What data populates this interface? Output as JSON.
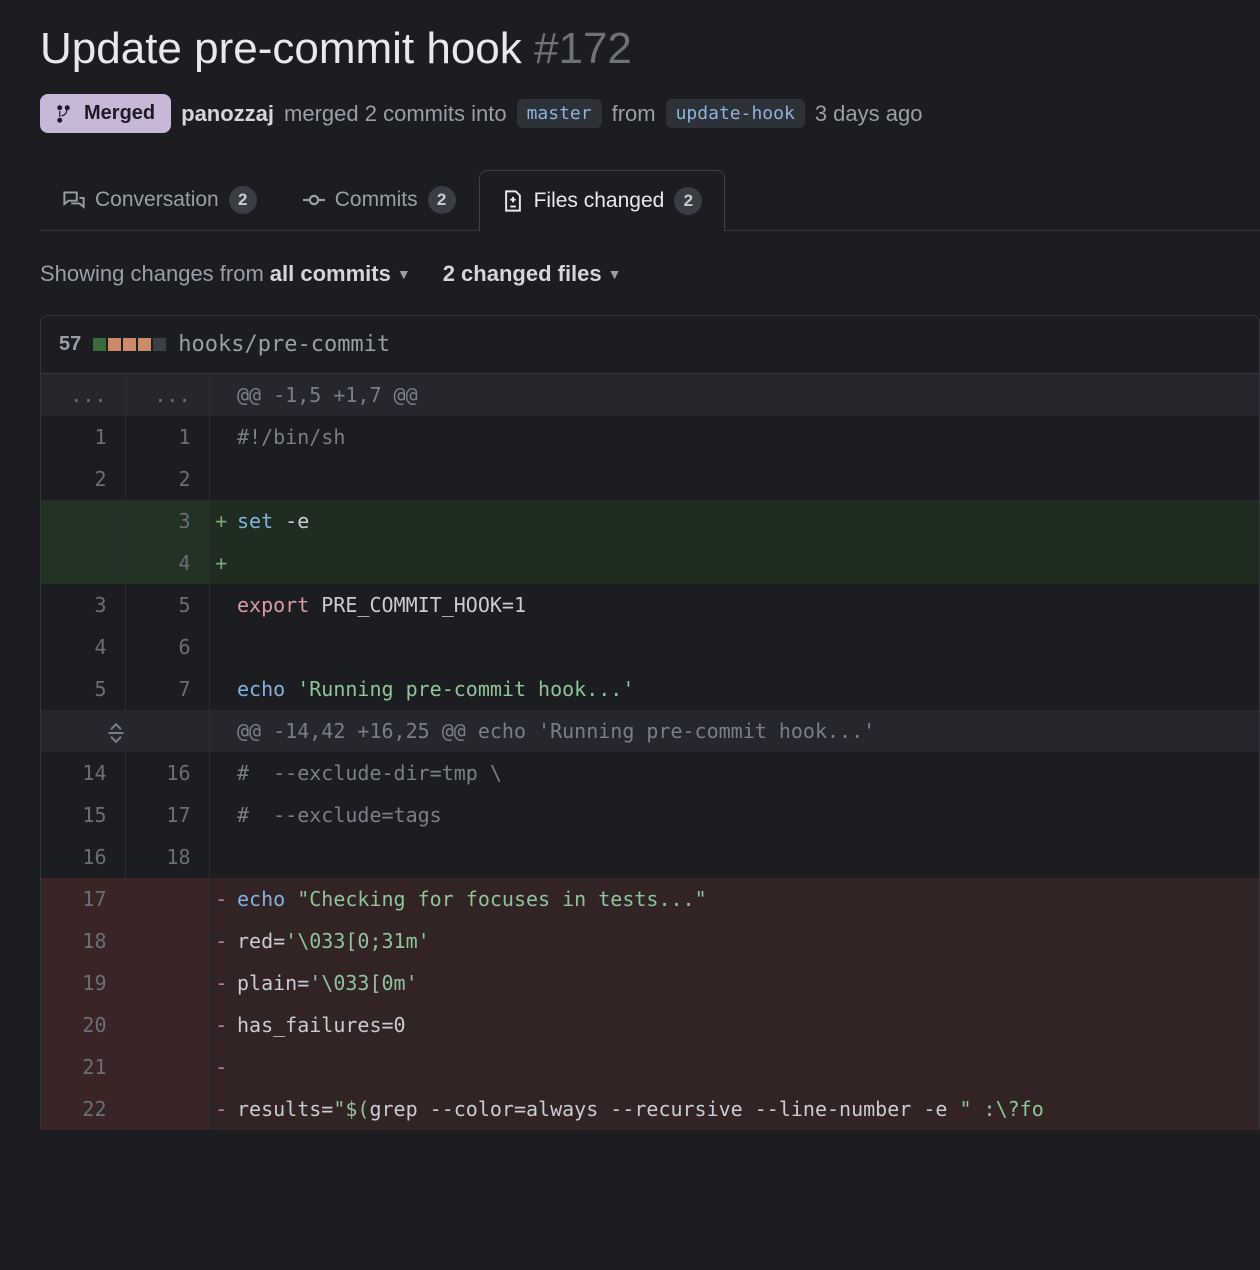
{
  "pr": {
    "title": "Update pre-commit hook",
    "number": "#172",
    "status_label": "Merged",
    "author": "panozzaj",
    "action_text_pre": "merged 2 commits into",
    "base_branch": "master",
    "action_text_mid": "from",
    "head_branch": "update-hook",
    "time_ago": "3 days ago"
  },
  "tabs": {
    "conversation": {
      "label": "Conversation",
      "count": "2"
    },
    "commits": {
      "label": "Commits",
      "count": "2"
    },
    "files": {
      "label": "Files changed",
      "count": "2"
    }
  },
  "toolbar": {
    "showing_prefix": "Showing changes from ",
    "commits_filter": "all commits",
    "files_filter": "2 changed files"
  },
  "file": {
    "stat": "57",
    "path": "hooks/pre-commit"
  },
  "diff": {
    "hunk1": {
      "ln_l": "...",
      "ln_r": "...",
      "text": "@@ -1,5 +1,7 @@"
    },
    "rows1": [
      {
        "type": "context",
        "l": "1",
        "r": "1",
        "html": "<span class='tk-comment'>#!/bin/sh</span>"
      },
      {
        "type": "context",
        "l": "2",
        "r": "2",
        "html": ""
      },
      {
        "type": "addition",
        "l": "",
        "r": "3",
        "html": "<span class='tk-cmd'>set</span> -e"
      },
      {
        "type": "addition",
        "l": "",
        "r": "4",
        "html": ""
      },
      {
        "type": "context",
        "l": "3",
        "r": "5",
        "html": "<span class='tk-kw'>export</span> PRE_COMMIT_HOOK=1"
      },
      {
        "type": "context",
        "l": "4",
        "r": "6",
        "html": ""
      },
      {
        "type": "context",
        "l": "5",
        "r": "7",
        "html": "<span class='tk-cmd'>echo</span> <span class='tk-str'>'Running pre-commit hook...'</span>"
      }
    ],
    "hunk2": {
      "text": "@@ -14,42 +16,25 @@ echo 'Running pre-commit hook...'"
    },
    "rows2": [
      {
        "type": "context",
        "l": "14",
        "r": "16",
        "html": "<span class='tk-comment'>#  --exclude-dir=tmp \\</span>"
      },
      {
        "type": "context",
        "l": "15",
        "r": "17",
        "html": "<span class='tk-comment'>#  --exclude=tags</span>"
      },
      {
        "type": "context",
        "l": "16",
        "r": "18",
        "html": ""
      },
      {
        "type": "deletion",
        "l": "17",
        "r": "",
        "html": "<span class='tk-cmd'>echo</span> <span class='tk-str'>\"Checking for focuses in tests...\"</span>"
      },
      {
        "type": "deletion",
        "l": "18",
        "r": "",
        "html": "red=<span class='tk-str'>'\\033[0;31m'</span>"
      },
      {
        "type": "deletion",
        "l": "19",
        "r": "",
        "html": "plain=<span class='tk-str'>'\\033[0m'</span>"
      },
      {
        "type": "deletion",
        "l": "20",
        "r": "",
        "html": "has_failures=0"
      },
      {
        "type": "deletion",
        "l": "21",
        "r": "",
        "html": ""
      },
      {
        "type": "deletion",
        "l": "22",
        "r": "",
        "html": "results=<span class='tk-str'>\"$(</span>grep --color=always --recursive --line-number -e <span class='tk-str'>\" :\\?fo</span>"
      }
    ]
  }
}
